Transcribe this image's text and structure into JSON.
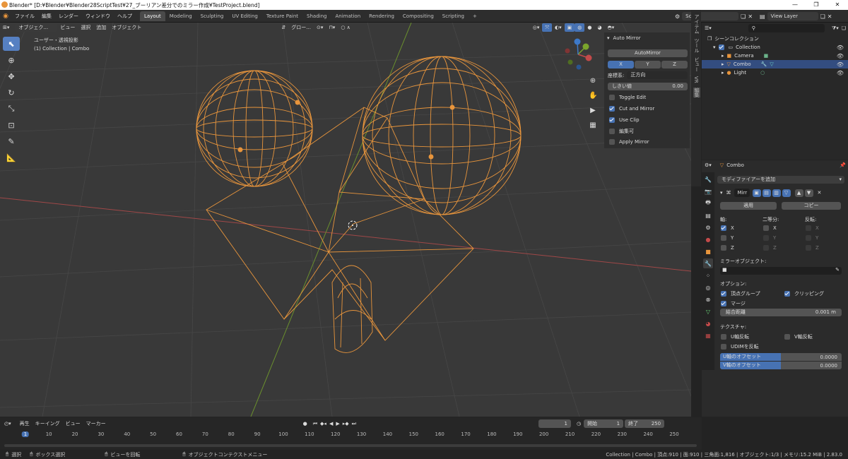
{
  "window": {
    "title": "Blender* [D:¥Blender¥Blender28ScriptTest¥27_ブーリアン差分でのミラー作成¥TestProject.blend]",
    "minimize": "—",
    "maximize": "❐",
    "close": "✕"
  },
  "menu": [
    "ファイル",
    "編集",
    "レンダー",
    "ウィンドウ",
    "ヘルプ"
  ],
  "workspaces": [
    "Layout",
    "Modeling",
    "Sculpting",
    "UV Editing",
    "Texture Paint",
    "Shading",
    "Animation",
    "Rendering",
    "Compositing",
    "Scripting"
  ],
  "workspace_add": "+",
  "scene": {
    "name": "Scene",
    "view_layer": "View Layer"
  },
  "viewport": {
    "mode": "オブジェク...",
    "menus": [
      "ビュー",
      "選択",
      "追加",
      "オブジェクト"
    ],
    "transform_orientation": "グロー...",
    "view_name": "ユーザー・透視投影",
    "object_info": "(1) Collection | Combo",
    "gizmo_axes": {
      "x": "X",
      "y": "Y",
      "z": "Z"
    }
  },
  "npanel": {
    "title": "Auto Mirror",
    "automirror_button": "AutoMirror",
    "axes": [
      "X",
      "Y",
      "Z"
    ],
    "axis_selected": "X",
    "orientation_label": "座標系:",
    "orientation_value": "正方向",
    "threshold_label": "しきい値",
    "threshold_value": "0.00",
    "options": [
      {
        "label": "Toggle Edit",
        "checked": false
      },
      {
        "label": "Cut and Mirror",
        "checked": true
      },
      {
        "label": "Use Clip",
        "checked": true
      },
      {
        "label": "編集可",
        "checked": false
      },
      {
        "label": "Apply Mirror",
        "checked": false
      }
    ],
    "tabs": [
      "アイテム",
      "ツール",
      "ビュー",
      "VR",
      "編集"
    ]
  },
  "outliner": {
    "search_placeholder": "",
    "root": "シーンコレクション",
    "collection": "Collection",
    "items": [
      {
        "label": "Camera",
        "selected": false
      },
      {
        "label": "Combo",
        "selected": true
      },
      {
        "label": "Light",
        "selected": false
      }
    ]
  },
  "properties": {
    "object_name": "Combo",
    "add_modifier": "モディファイアーを追加",
    "modifier_name": "Mirr",
    "apply": "適用",
    "copy": "コピー",
    "axis_header": "軸:",
    "bisect_header": "二等分:",
    "flip_header": "反転:",
    "axis": [
      {
        "label": "X",
        "checked": true
      },
      {
        "label": "Y",
        "checked": false
      },
      {
        "label": "Z",
        "checked": false
      }
    ],
    "bisect": [
      {
        "label": "X",
        "checked": false
      },
      {
        "label": "Y",
        "checked": false
      },
      {
        "label": "Z",
        "checked": false
      }
    ],
    "flip": [
      {
        "label": "X",
        "checked": false
      },
      {
        "label": "Y",
        "checked": false
      },
      {
        "label": "Z",
        "checked": false
      }
    ],
    "mirror_object_label": "ミラーオブジェクト:",
    "options_label": "オプション:",
    "vertex_groups": "頂点グループ",
    "clipping": "クリッピング",
    "merge": "マージ",
    "merge_distance_label": "結合距離",
    "merge_distance_value": "0.001 m",
    "texture_label": "テクスチャ:",
    "u_flip": "U軸反転",
    "v_flip": "V軸反転",
    "udim_flip": "UDIMを反転",
    "u_offset_label": "U軸のオフセット",
    "u_offset_value": "0.0000",
    "v_offset_label": "V軸のオフセット",
    "v_offset_value": "0.0000"
  },
  "timeline": {
    "menus": [
      "再生",
      "キーイング",
      "ビュー",
      "マーカー"
    ],
    "current_frame": "1",
    "start_label": "開始",
    "start_value": "1",
    "end_label": "終了",
    "end_value": "250",
    "ticks": [
      "1",
      "10",
      "20",
      "30",
      "40",
      "50",
      "60",
      "70",
      "80",
      "90",
      "100",
      "110",
      "120",
      "130",
      "140",
      "150",
      "160",
      "170",
      "180",
      "190",
      "200",
      "210",
      "220",
      "230",
      "240",
      "250"
    ]
  },
  "statusbar": {
    "select": "選択",
    "box_select": "ボックス選択",
    "rotate_view": "ビューを回転",
    "context_menu": "オブジェクトコンテクストメニュー",
    "stats": "Collection | Combo | 頂点:910 | 面:910 | 三角面:1,816 | オブジェクト:1/3 | メモリ:15.2 MiB | 2.83.0"
  },
  "colors": {
    "accent": "#4772b3",
    "wire": "#e8953c",
    "x_axis": "#c34a4a",
    "y_axis": "#7aa52c",
    "z_axis": "#3d79c8"
  }
}
